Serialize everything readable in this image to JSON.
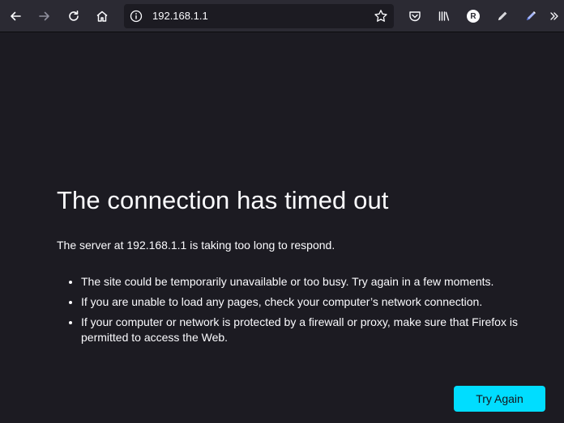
{
  "toolbar": {
    "back_icon": "arrow-left-icon",
    "forward_icon": "arrow-right-icon",
    "reload_icon": "reload-icon",
    "home_icon": "home-icon",
    "url": "192.168.1.1",
    "info_icon": "info-icon",
    "bookmark_icon": "star-icon",
    "pocket_icon": "pocket-icon",
    "library_icon": "library-icon",
    "account_initial": "R",
    "extension1_icon": "pencil-icon",
    "extension2_icon": "pen-icon",
    "overflow_icon": "chevron-double-right-icon"
  },
  "error": {
    "title": "The connection has timed out",
    "description": "The server at 192.168.1.1 is taking too long to respond.",
    "bullets": [
      "The site could be temporarily unavailable or too busy. Try again in a few moments.",
      "If you are unable to load any pages, check your computer’s network connection.",
      "If your computer or network is protected by a firewall or proxy, make sure that Firefox is permitted to access the Web."
    ],
    "button_label": "Try Again"
  },
  "colors": {
    "page_bg": "#1c1b22",
    "toolbar_bg": "#2b2a33",
    "text": "#fbfbfe",
    "accent_button": "#00ddff"
  }
}
